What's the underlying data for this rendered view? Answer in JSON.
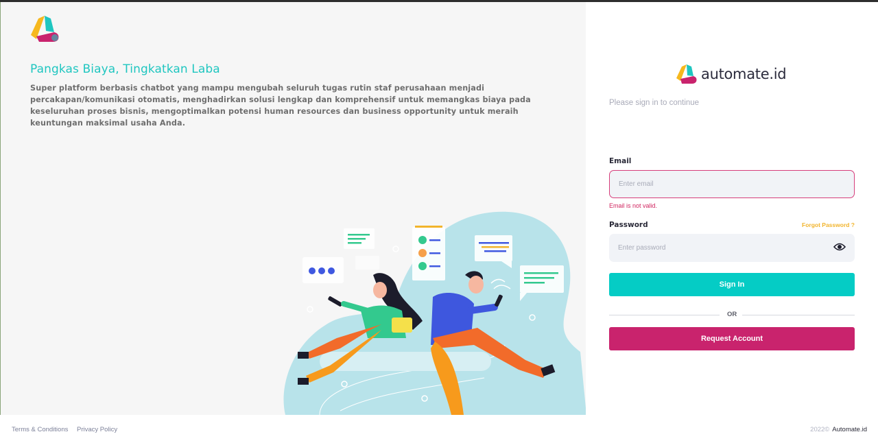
{
  "colors": {
    "accent_teal": "#05ccc5",
    "accent_magenta": "#c9236d",
    "warning_yellow": "#f2b42c",
    "error_red": "#d0245f"
  },
  "hero": {
    "title": "Pangkas Biaya, Tingkatkan Laba",
    "description": "Super platform berbasis chatbot yang mampu mengubah seluruh tugas rutin staf perusahaan menjadi percakapan/komunikasi otomatis, menghadirkan solusi lengkap dan komprehensif untuk memangkas biaya pada keseluruhan proses bisnis, mengoptimalkan potensi human resources dan business opportunity untuk meraih keuntungan maksimal usaha Anda."
  },
  "login": {
    "brand_name": "automate.id",
    "subtitle": "Please sign in to continue",
    "email_label": "Email",
    "email_placeholder": "Enter email",
    "email_error": "Email is not valid.",
    "password_label": "Password",
    "forgot_label": "Forgot Password ?",
    "password_placeholder": "Enter password",
    "signin_label": "Sign In",
    "or_label": "OR",
    "request_label": "Request Account",
    "icons": {
      "password_toggle": "eye-icon"
    }
  },
  "footer": {
    "terms_label": "Terms & Conditions",
    "privacy_label": "Privacy Policy",
    "year": "2022©",
    "company": "Automate.id"
  }
}
